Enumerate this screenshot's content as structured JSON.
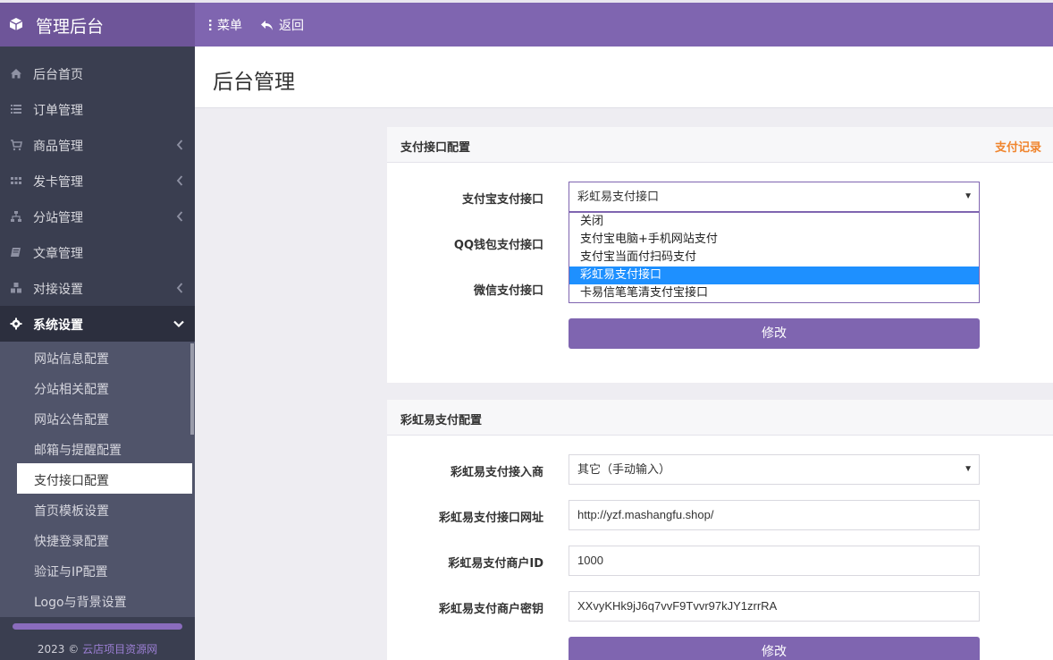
{
  "header": {
    "app_title": "管理后台",
    "menu_label": "菜单",
    "back_label": "返回"
  },
  "sidebar": {
    "items": [
      {
        "label": "后台首页",
        "icon": "home-icon",
        "has_chevron": false
      },
      {
        "label": "订单管理",
        "icon": "list-icon",
        "has_chevron": false
      },
      {
        "label": "商品管理",
        "icon": "cart-icon",
        "has_chevron": true
      },
      {
        "label": "发卡管理",
        "icon": "grid-icon",
        "has_chevron": true
      },
      {
        "label": "分站管理",
        "icon": "sitemap-icon",
        "has_chevron": true
      },
      {
        "label": "文章管理",
        "icon": "book-icon",
        "has_chevron": false
      },
      {
        "label": "对接设置",
        "icon": "cubes-icon",
        "has_chevron": true
      },
      {
        "label": "系统设置",
        "icon": "gear-icon",
        "has_chevron": true,
        "active": true
      }
    ],
    "submenu": [
      "网站信息配置",
      "分站相关配置",
      "网站公告配置",
      "邮箱与提醒配置",
      "支付接口配置",
      "首页模板设置",
      "快捷登录配置",
      "验证与IP配置",
      "Logo与背景设置"
    ],
    "current_submenu": "支付接口配置",
    "copyright_prefix": "2023 ©",
    "copyright_link": "云店项目资源网"
  },
  "main": {
    "page_title": "后台管理"
  },
  "payment_panel": {
    "title": "支付接口配置",
    "link": "支付记录",
    "fields": [
      {
        "label": "支付宝支付接口",
        "value": "彩虹易支付接口"
      },
      {
        "label": "QQ钱包支付接口",
        "value": ""
      },
      {
        "label": "微信支付接口",
        "value": ""
      }
    ],
    "dropdown_options": [
      "关闭",
      "支付宝电脑+手机网站支付",
      "支付宝当面付扫码支付",
      "彩虹易支付接口",
      "卡易信笔笔清支付宝接口"
    ],
    "selected_option": "彩虹易支付接口",
    "submit_label": "修改"
  },
  "epay_panel": {
    "title": "彩虹易支付配置",
    "fields": [
      {
        "label": "彩虹易支付接入商",
        "value": "其它（手动输入）"
      },
      {
        "label": "彩虹易支付接口网址",
        "value": "http://yzf.mashangfu.shop/"
      },
      {
        "label": "彩虹易支付商户ID",
        "value": "1000"
      },
      {
        "label": "彩虹易支付商户密钥",
        "value": "XXvyKHk9jJ6q7vvF9Tvvr97kJY1zrrRA"
      }
    ],
    "submit_label": "修改"
  },
  "colors": {
    "accent": "#7f65b0",
    "sidebar_bg": "#3a3e50",
    "link_orange": "#f0852e",
    "option_highlight": "#1e90ff"
  }
}
